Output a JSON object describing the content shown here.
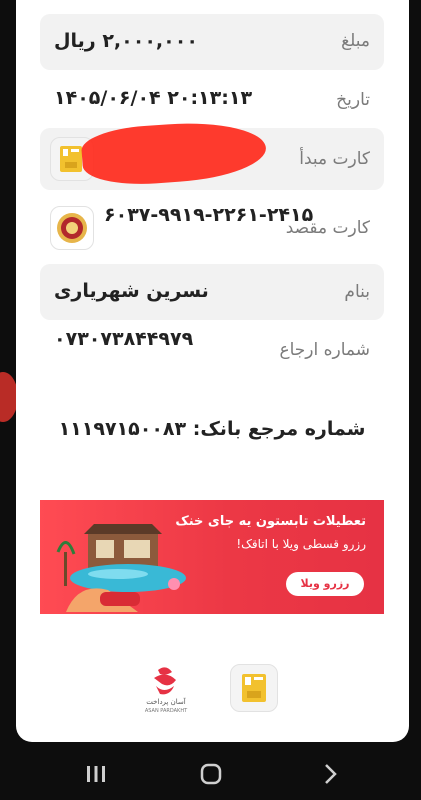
{
  "receipt": {
    "amount": {
      "label": "مبلغ",
      "value": "۲,۰۰۰,۰۰۰ ریال"
    },
    "date": {
      "label": "تاریخ",
      "value": "۱۴۰۵/۰۶/۰۴ ۲۰:۱۳:۱۳"
    },
    "source_card": {
      "label": "کارت مبدأ"
    },
    "dest_card": {
      "label": "کارت مقصد",
      "value": "۶۰۳۷-۹۹۱۹-۲۲۶۱-۲۴۱۵"
    },
    "name": {
      "label": "بنام",
      "value": "نسرین شهریاری"
    },
    "reference": {
      "label": "شماره ارجاع",
      "value": "۰۷۳۰۷۳۸۴۴۹۷۹"
    },
    "bank_ref": "شماره مرجع بانک: ۱۱۱۹۷۱۵۰۰۸۳"
  },
  "banner": {
    "line1": "تعطیلات تابستون یه جای خنک",
    "line2": "رزرو قسطی ویلا با اتاقک!",
    "button": "رزرو ویلا"
  },
  "footer": {
    "asan_logo_text": "آسان پرداخت",
    "asan_logo_latin": "ASAN PARDAKHT"
  },
  "icons": {
    "source_bank": "bank-logo-icon",
    "dest_bank": "bank-melli-logo-icon",
    "nav_recent": "recent-apps-icon",
    "nav_home": "home-icon",
    "nav_back": "back-icon"
  }
}
